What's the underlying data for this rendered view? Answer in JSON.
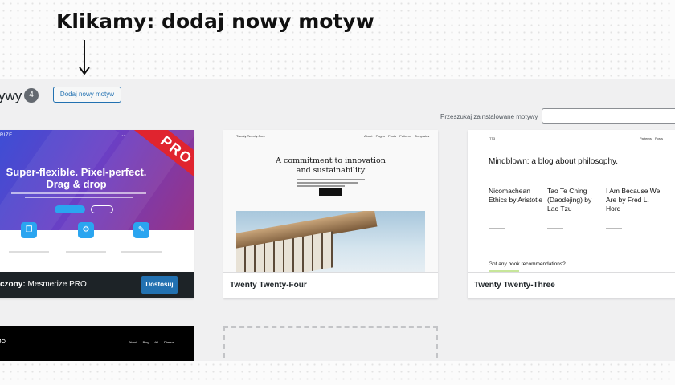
{
  "annotation": {
    "title": "Klikamy: dodaj nowy motyw"
  },
  "header": {
    "title": "ywy",
    "count": "4",
    "add_new_label": "Dodaj nowy motyw"
  },
  "search": {
    "label": "Przeszukaj zainstalowane motywy",
    "value": ""
  },
  "themes": [
    {
      "name": "Mesmerize PRO",
      "active_prefix": "czony:",
      "active": true,
      "action_label": "Dostosuj",
      "ribbon": "PRO",
      "preview": {
        "logo": "RIZE",
        "nav": "····",
        "headline_line1": "Super-flexible. Pixel-perfect.",
        "headline_line2": "Drag & drop"
      }
    },
    {
      "name": "Twenty Twenty-Four",
      "preview": {
        "site_title": "Twenty Twenty-Four",
        "nav": "About Pages Posts Patterns Templates",
        "headline_line1": "A commitment to innovation",
        "headline_line2": "and sustainability"
      }
    },
    {
      "name": "Twenty Twenty-Three",
      "preview": {
        "site_title": "TT3",
        "nav": "Patterns Posts",
        "headline": "Mindblown: a blog about philosophy.",
        "posts": [
          "Nicomachean Ethics by Aristotle",
          "Tao Te Ching (Daodejing) by Lao Tzu",
          "I Am Because We Are by Fred L. Hord"
        ],
        "bottom_text": "Got any book recommendations?"
      }
    },
    {
      "name": "",
      "preview": {
        "logo": "JO",
        "nav": "About Blog All Places"
      }
    }
  ],
  "colors": {
    "accent": "#2271b1",
    "pro_ribbon": "#e0242f",
    "admin_bg": "#f0f0f1"
  },
  "icons": [
    "down-arrow-icon"
  ]
}
